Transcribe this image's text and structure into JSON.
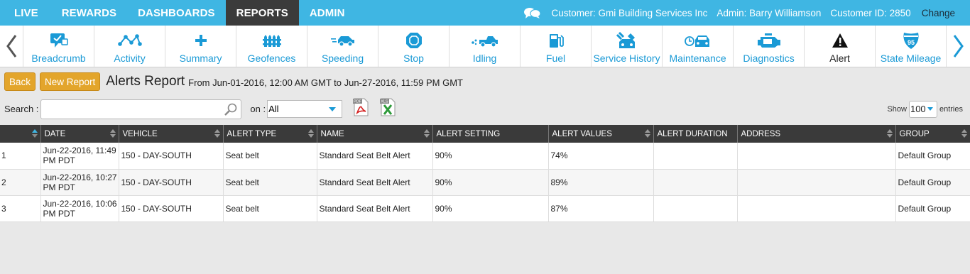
{
  "topnav": {
    "items": [
      "LIVE",
      "REWARDS",
      "DASHBOARDS",
      "REPORTS",
      "ADMIN"
    ],
    "active_index": 3,
    "customer": "Customer: Gmi Building Services Inc",
    "admin": "Admin: Barry Williamson",
    "customer_id": "Customer ID: 2850",
    "change": "Change"
  },
  "toolbar": {
    "items": [
      {
        "label": "Breadcrumb",
        "icon": "breadcrumb-icon"
      },
      {
        "label": "Activity",
        "icon": "activity-icon"
      },
      {
        "label": "Summary",
        "icon": "plus-icon"
      },
      {
        "label": "Geofences",
        "icon": "fence-icon"
      },
      {
        "label": "Speeding",
        "icon": "speeding-car-icon"
      },
      {
        "label": "Stop",
        "icon": "stop-hexagon-icon"
      },
      {
        "label": "Idling",
        "icon": "idling-car-icon"
      },
      {
        "label": "Fuel",
        "icon": "fuel-pump-icon"
      },
      {
        "label": "Service History",
        "icon": "service-tools-icon"
      },
      {
        "label": "Maintenance",
        "icon": "maintenance-car-icon"
      },
      {
        "label": "Diagnostics",
        "icon": "engine-icon"
      },
      {
        "label": "Alert",
        "icon": "alert-triangle-icon"
      },
      {
        "label": "State Mileage",
        "icon": "interstate-shield-icon"
      }
    ]
  },
  "report": {
    "back_label": "Back",
    "new_label": "New Report",
    "title": "Alerts Report",
    "range": "From Jun-01-2016, 12:00 AM GMT to Jun-27-2016, 11:59 PM GMT"
  },
  "search": {
    "label": "Search :",
    "value": "",
    "on_label": "on :",
    "on_value": "All",
    "show_label": "Show",
    "show_value": "100",
    "entries_label": "entries"
  },
  "table": {
    "columns": [
      "",
      "DATE",
      "VEHICLE",
      "ALERT TYPE",
      "NAME",
      "ALERT SETTING",
      "ALERT VALUES",
      "ALERT DURATION",
      "ADDRESS",
      "GROUP"
    ],
    "rows": [
      [
        "1",
        "Jun-22-2016, 11:49 PM PDT",
        "150 - DAY-SOUTH",
        "Seat belt",
        "Standard Seat Belt Alert",
        "90%",
        "74%",
        "",
        "",
        "Default Group"
      ],
      [
        "2",
        "Jun-22-2016, 10:27 PM PDT",
        "150 - DAY-SOUTH",
        "Seat belt",
        "Standard Seat Belt Alert",
        "90%",
        "89%",
        "",
        "",
        "Default Group"
      ],
      [
        "3",
        "Jun-22-2016, 10:06 PM PDT",
        "150 - DAY-SOUTH",
        "Seat belt",
        "Standard Seat Belt Alert",
        "90%",
        "87%",
        "",
        "",
        "Default Group"
      ]
    ]
  },
  "colors": {
    "brand": "#3fb6e3",
    "active_nav": "#3b3b3b",
    "button": "#e3a52b",
    "link": "#1a9ad6"
  }
}
